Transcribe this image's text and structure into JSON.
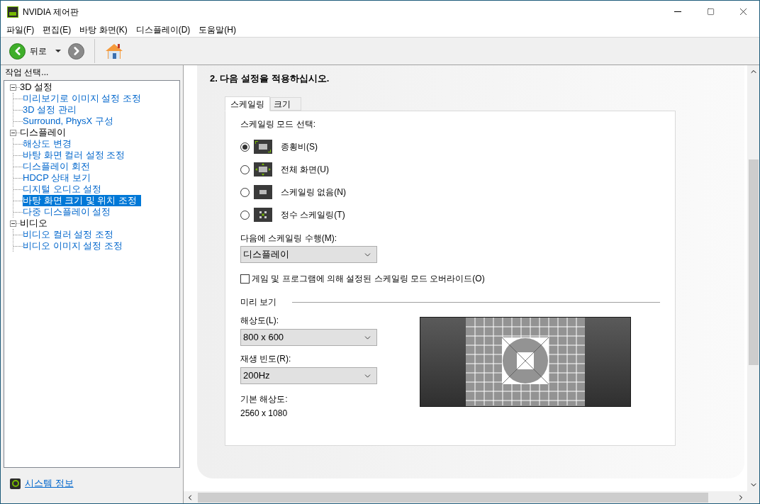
{
  "window": {
    "title": "NVIDIA 제어판"
  },
  "menu": [
    "파일(F)",
    "편집(E)",
    "바탕 화면(K)",
    "디스플레이(D)",
    "도움말(H)"
  ],
  "toolbar": {
    "back_label": "뒤로"
  },
  "sidebar": {
    "label": "작업 선택...",
    "tree": [
      {
        "label": "3D 설정",
        "expanded": true,
        "children": [
          {
            "label": "미리보기로 이미지 설정 조정",
            "selected": false
          },
          {
            "label": "3D 설정 관리",
            "selected": false
          },
          {
            "label": "Surround, PhysX 구성",
            "selected": false
          }
        ]
      },
      {
        "label": "디스플레이",
        "expanded": true,
        "children": [
          {
            "label": "해상도 변경",
            "selected": false
          },
          {
            "label": "바탕 화면 컬러 설정 조정",
            "selected": false
          },
          {
            "label": "디스플레이 회전",
            "selected": false
          },
          {
            "label": "HDCP 상태 보기",
            "selected": false
          },
          {
            "label": "디지털 오디오 설정",
            "selected": false
          },
          {
            "label": "바탕 화면 크기 및 위치 조정",
            "selected": true
          },
          {
            "label": "다중 디스플레이 설정",
            "selected": false
          }
        ]
      },
      {
        "label": "비디오",
        "expanded": true,
        "children": [
          {
            "label": "비디오 컬러 설정 조정",
            "selected": false
          },
          {
            "label": "비디오 이미지 설정 조정",
            "selected": false
          }
        ]
      }
    ],
    "footer_link": "시스템 정보"
  },
  "content": {
    "heading": "2. 다음 설정을 적용하십시오.",
    "tabs": [
      {
        "label": "스케일링",
        "selected": true
      },
      {
        "label": "크기",
        "selected": false
      }
    ],
    "mode_label": "스케일링 모드 선택:",
    "modes": [
      {
        "kind": "aspect",
        "label": "종횡비(S)",
        "selected": true
      },
      {
        "kind": "fullscreen",
        "label": "전체 화면(U)",
        "selected": false
      },
      {
        "kind": "none",
        "label": "스케일링 없음(N)",
        "selected": false
      },
      {
        "kind": "integer",
        "label": "정수 스케일링(T)",
        "selected": false
      }
    ],
    "perform_on": {
      "label": "다음에 스케일링 수행(M):",
      "value": "디스플레이"
    },
    "override": {
      "label": "게임 및 프로그램에 의해 설정된 스케일링 모드 오버라이드(O)",
      "checked": false
    },
    "preview": {
      "label": "미리 보기",
      "resolution": {
        "label": "해상도(L):",
        "value": "800 x 600"
      },
      "refresh": {
        "label": "재생 빈도(R):",
        "value": "200Hz"
      },
      "native": {
        "label": "기본 해상도:",
        "value": "2560 x 1080"
      }
    }
  }
}
